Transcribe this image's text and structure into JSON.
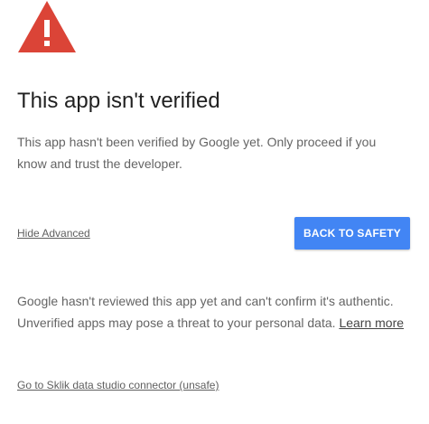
{
  "icon": {
    "name": "warning-icon",
    "color": "#db4437"
  },
  "title": "This app isn't verified",
  "description": "This app hasn't been verified by Google yet. Only proceed if you know and trust the developer.",
  "advanced_link": "Hide Advanced",
  "back_button": {
    "label": "BACK TO SAFETY",
    "color": "#4285f4"
  },
  "details": {
    "text": "Google hasn't reviewed this app yet and can't confirm it's authentic. Unverified apps may pose a threat to your personal data.",
    "learn_more": "Learn more"
  },
  "unsafe_link": "Go to Sklik data studio connector (unsafe)"
}
